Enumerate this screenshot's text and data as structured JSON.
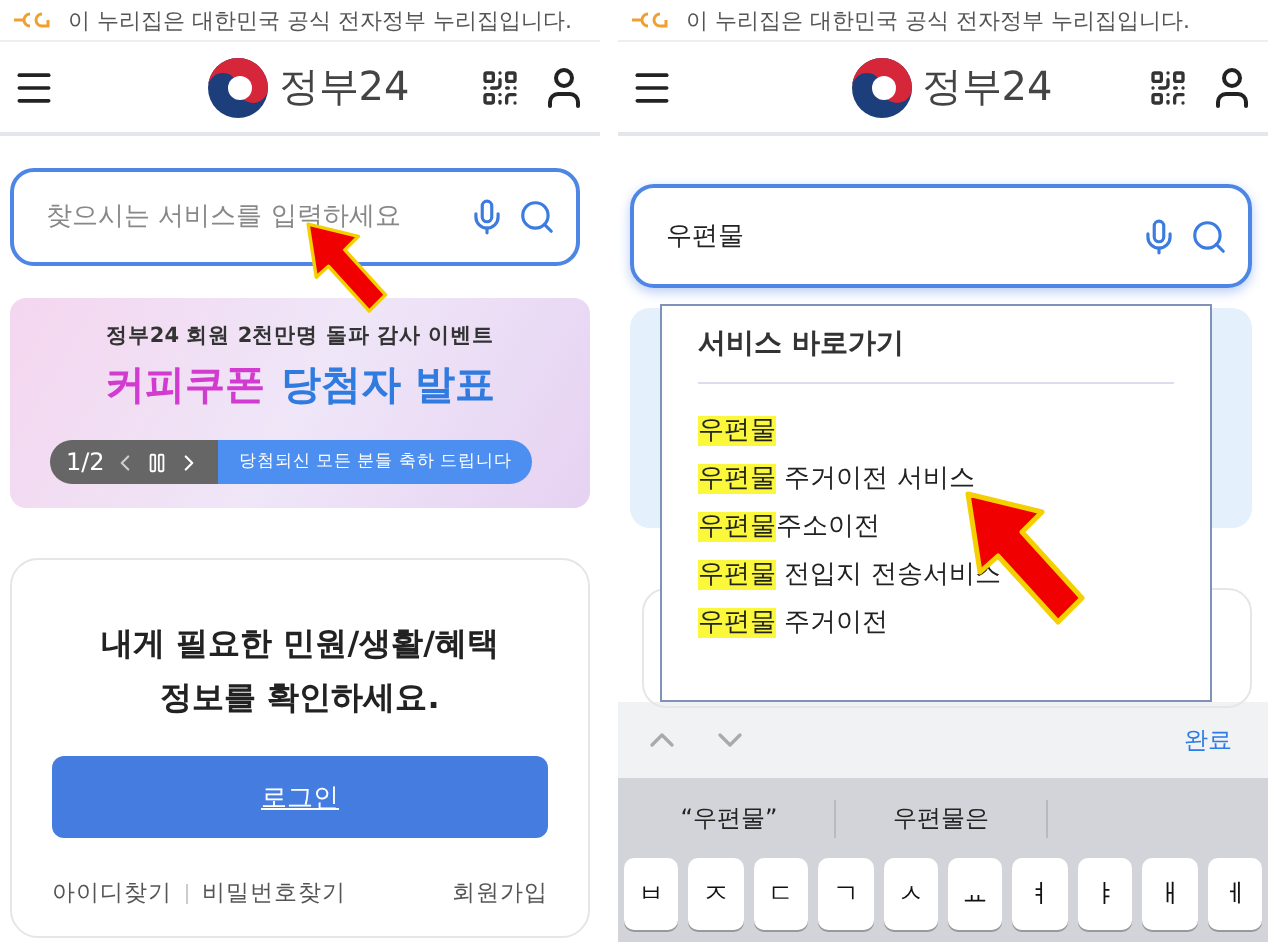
{
  "screens": [
    {
      "kind": "home",
      "notice": "이 누리집은 대한민국 공식 전자정부 누리집입니다.",
      "logo": "정부24",
      "search": {
        "placeholder": "찾으시는 서비스를 입력하세요"
      },
      "banner": {
        "subtitle": "정부24 회원 2천만명 돌파 감사 이벤트",
        "headline": [
          {
            "text": "커피쿠폰",
            "color": "#d23bd0"
          },
          {
            "text": "당첨자 발표",
            "color": "#2f7be0"
          }
        ],
        "counter": "1/2",
        "pill": "당첨되신 모든 분들 축하 드립니다"
      },
      "login": {
        "message_lines": [
          "내게 필요한 민원/생활/혜택",
          "정보를 확인하세요."
        ],
        "button": "로그인",
        "links": [
          "아이디찾기",
          "비밀번호찾기"
        ],
        "signup": "회원가입"
      }
    },
    {
      "kind": "search",
      "notice": "이 누리집은 대한민국 공식 전자정부 누리집입니다.",
      "logo": "정부24",
      "search": {
        "value": "우편물"
      },
      "dropdown": {
        "title": "서비스 바로가기",
        "items": [
          {
            "match": "우편물"
          },
          {
            "match": "우편물",
            "rest": " 주거이전 서비스"
          },
          {
            "match": "우편물",
            "rest": "주소이전"
          },
          {
            "match": "우편물",
            "rest": " 전입지 전송서비스"
          },
          {
            "match": "우편물",
            "rest": " 주거이전"
          }
        ]
      },
      "keyboard": {
        "done": "완료",
        "suggestions": [
          "“우편물”",
          "우편물은"
        ],
        "keys": [
          "ㅂ",
          "ㅈ",
          "ㄷ",
          "ㄱ",
          "ㅅ",
          "ㅛ",
          "ㅕ",
          "ㅑ",
          "ㅐ",
          "ㅔ"
        ]
      }
    }
  ]
}
